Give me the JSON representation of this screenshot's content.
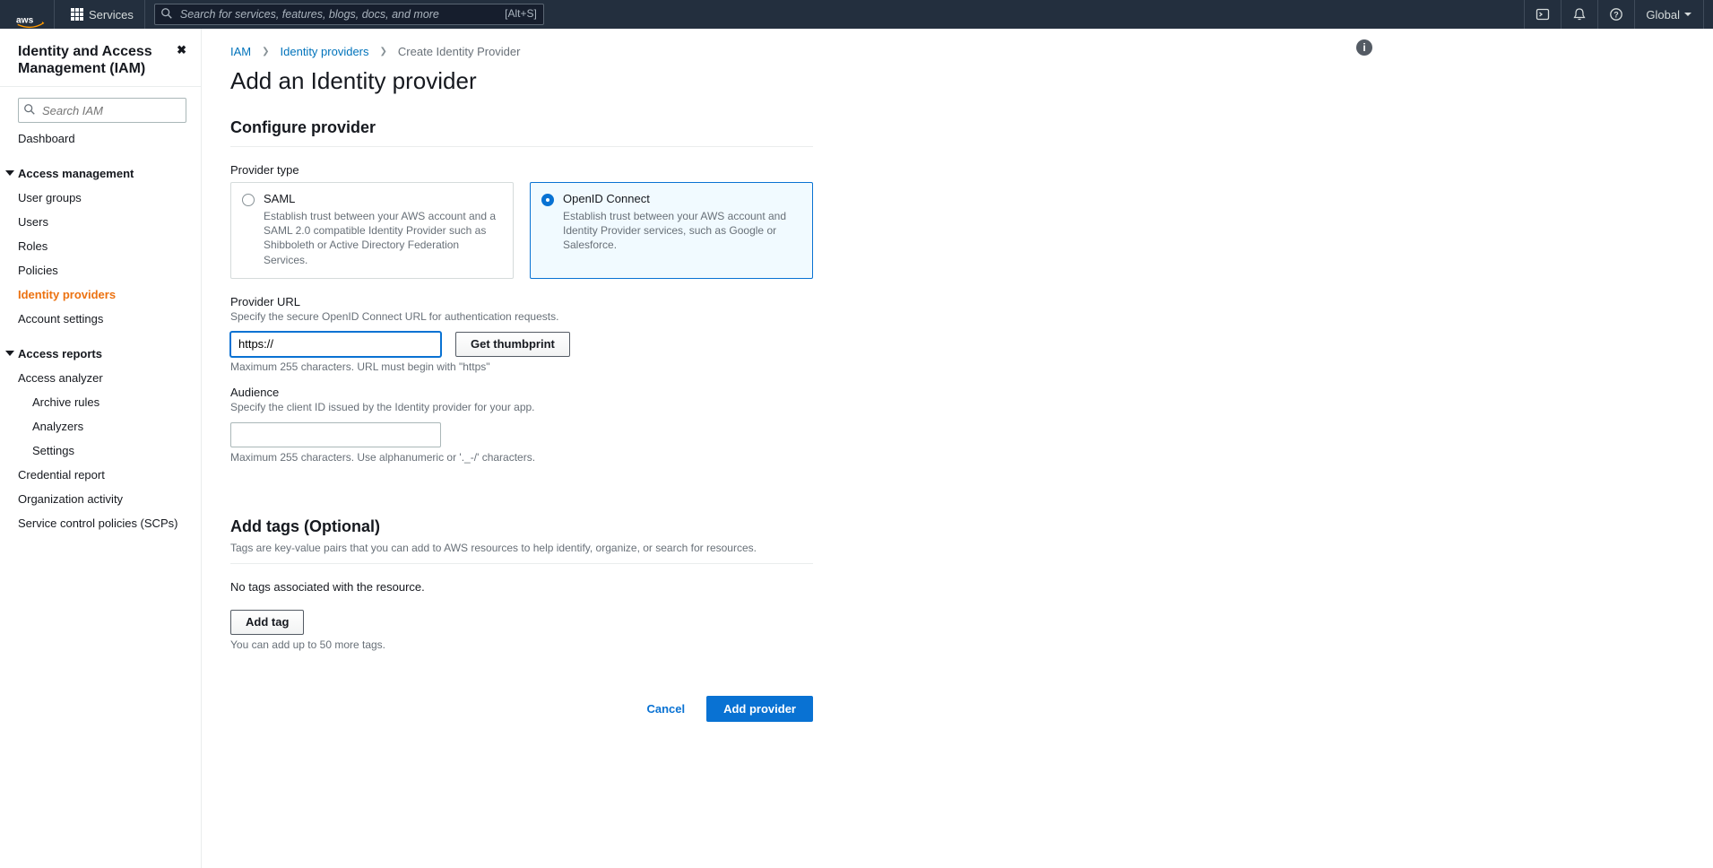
{
  "nav": {
    "services_label": "Services",
    "search_placeholder": "Search for services, features, blogs, docs, and more",
    "search_shortcut": "[Alt+S]",
    "region": "Global"
  },
  "sidebar": {
    "title": "Identity and Access Management (IAM)",
    "search_placeholder": "Search IAM",
    "dashboard": "Dashboard",
    "group_access": "Access management",
    "items_access": [
      "User groups",
      "Users",
      "Roles",
      "Policies",
      "Identity providers",
      "Account settings"
    ],
    "active_access_index": 4,
    "group_reports": "Access reports",
    "reports_root": "Access analyzer",
    "reports_children": [
      "Archive rules",
      "Analyzers",
      "Settings"
    ],
    "reports_rest": [
      "Credential report",
      "Organization activity",
      "Service control policies (SCPs)"
    ]
  },
  "crumbs": {
    "a": "IAM",
    "b": "Identity providers",
    "c": "Create Identity Provider"
  },
  "page_title": "Add an Identity provider",
  "config": {
    "header": "Configure provider",
    "type_label": "Provider type",
    "saml": {
      "name": "SAML",
      "desc": "Establish trust between your AWS account and a SAML 2.0 compatible Identity Provider such as Shibboleth or Active Directory Federation Services."
    },
    "oidc": {
      "name": "OpenID Connect",
      "desc": "Establish trust between your AWS account and Identity Provider services, such as Google or Salesforce."
    },
    "url_label": "Provider URL",
    "url_desc": "Specify the secure OpenID Connect URL for authentication requests.",
    "url_value": "https://",
    "url_hint": "Maximum 255 characters. URL must begin with \"https\"",
    "thumb_btn": "Get thumbprint",
    "aud_label": "Audience",
    "aud_desc": "Specify the client ID issued by the Identity provider for your app.",
    "aud_hint": "Maximum 255 characters. Use alphanumeric or '._-/' characters."
  },
  "tags": {
    "header": "Add tags (Optional)",
    "desc": "Tags are key-value pairs that you can add to AWS resources to help identify, organize, or search for resources.",
    "empty": "No tags associated with the resource.",
    "add_btn": "Add tag",
    "hint": "You can add up to 50 more tags."
  },
  "footer": {
    "cancel": "Cancel",
    "submit": "Add provider"
  }
}
